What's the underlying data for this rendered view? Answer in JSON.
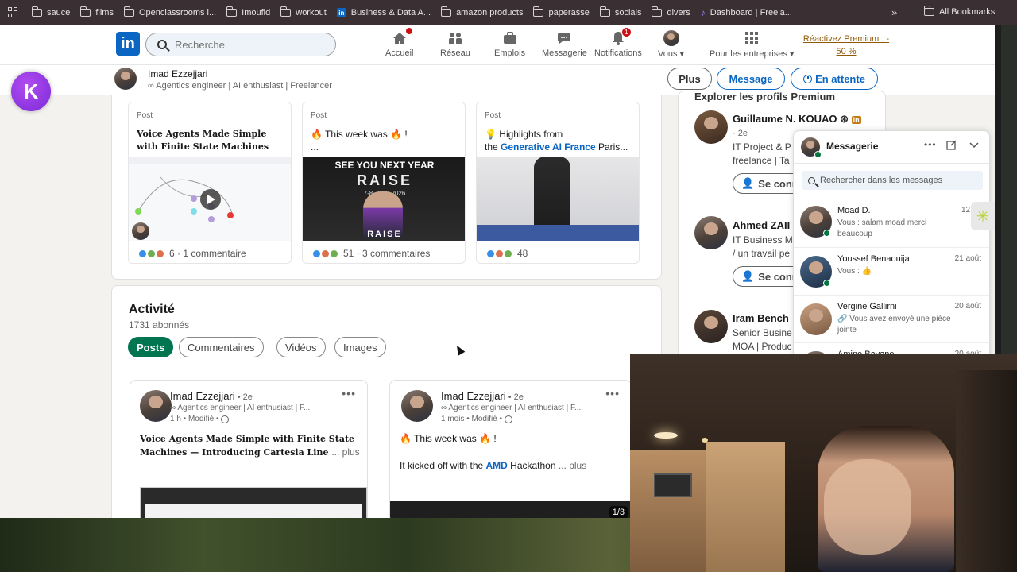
{
  "bookmarks": {
    "items": [
      "sauce",
      "films",
      "Openclassrooms l...",
      "Imoufid",
      "workout",
      "Business & Data A...",
      "amazon products",
      "paperasse",
      "socials",
      "divers",
      "Dashboard | Freela..."
    ],
    "more": "»",
    "all": "All Bookmarks"
  },
  "nav": {
    "logo": "in",
    "search_placeholder": "Recherche",
    "items": [
      {
        "label": "Accueil",
        "badge": "0",
        "icon": "home-icon"
      },
      {
        "label": "Réseau",
        "badge": "",
        "icon": "network-icon"
      },
      {
        "label": "Emplois",
        "badge": "",
        "icon": "jobs-icon"
      },
      {
        "label": "Messagerie",
        "badge": "",
        "icon": "messaging-icon"
      },
      {
        "label": "Notifications",
        "badge": "1",
        "icon": "bell-icon"
      },
      {
        "label": "Vous ▾",
        "badge": "",
        "icon": "avatar"
      },
      {
        "label": "Pour les entreprises ▾",
        "badge": "",
        "icon": "grid-icon"
      }
    ],
    "premium_line1": "Réactivez Premium : -",
    "premium_line2": "50 %"
  },
  "profile_bar": {
    "name": "Imad Ezzejjari",
    "headline": "∞ Agentics engineer | AI enthusiast | Freelancer",
    "btn_more": "Plus",
    "btn_message": "Message",
    "btn_pending": "En attente"
  },
  "posts": [
    {
      "type": "Post",
      "title": "Voice Agents Made Simple with Finite State Machines —...",
      "reactions": "6 · 1 commentaire"
    },
    {
      "type": "Post",
      "title_l1": "🔥 This week was 🔥 !",
      "title_l2": "...",
      "reactions": "51 · 3 commentaires",
      "image_text_1": "SEE YOU NEXT YEAR",
      "image_text_2": "RAISE",
      "image_text_3": "7-8 JULY 2026",
      "image_text_4": "RAISE"
    },
    {
      "type": "Post",
      "title_l1": "💡 Highlights from",
      "title_l2_pre": "the ",
      "title_l2_link": "Generative AI France",
      "title_l2_post": " Paris...",
      "reactions": "48"
    }
  ],
  "activity": {
    "title": "Activité",
    "followers": "1731 abonnés",
    "chips": [
      "Posts",
      "Commentaires",
      "Vidéos",
      "Images"
    ],
    "feed": [
      {
        "name": "Imad Ezzejjari",
        "degree": " • 2e",
        "headline": "∞ Agentics engineer | AI enthusiast | F...",
        "time": "1 h • Modifié •",
        "text": "Voice Agents Made Simple with Finite State Machines — Introducing Cartesia Line",
        "more": "... plus"
      },
      {
        "name": "Imad Ezzejjari",
        "degree": " • 2e",
        "headline": "∞ Agentics engineer | AI enthusiast | F...",
        "time": "1 mois • Modifié •",
        "text_l1": "🔥 This week was 🔥 !",
        "text_l2_pre": "It kicked off with the ",
        "text_l2_link": "AMD",
        "text_l2_post": " Hackathon",
        "more": "... plus",
        "counter": "1/3"
      }
    ]
  },
  "sidebar": {
    "title": "Explorer les profils Premium",
    "people": [
      {
        "name": "Guillaume N. KOUAO",
        "deg": "· 2e",
        "l1": "IT Project & P",
        "l2": "freelance | Ta"
      },
      {
        "name": "Ahmed ZAII",
        "l1": "IT Business M",
        "l2": "/ un travail pe"
      },
      {
        "name": "Iram Bench",
        "l1": "Senior Busine",
        "l2": "MOA | Produc"
      }
    ],
    "connect": "Se conn"
  },
  "messaging": {
    "title": "Messagerie",
    "search": "Rechercher dans les messages",
    "convs": [
      {
        "name": "Moad D.",
        "date": "12:32",
        "preview": "Vous : salam moad merci beaucoup"
      },
      {
        "name": "Youssef Benaouija",
        "date": "21 août",
        "preview": "Vous : 👍"
      },
      {
        "name": "Vergine Gallirni",
        "date": "20 août",
        "preview": "🔗 Vous avez envoyé une pièce jointe"
      },
      {
        "name": "Amine Bayane",
        "date": "20 août",
        "preview": ""
      }
    ]
  }
}
